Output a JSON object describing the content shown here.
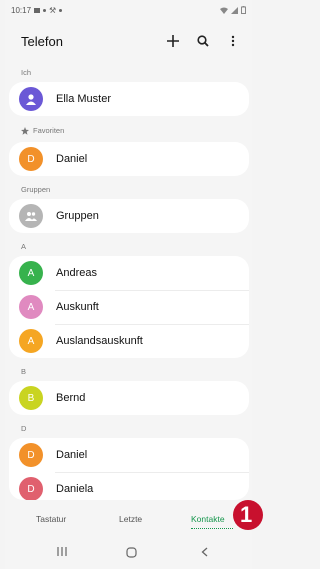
{
  "status": {
    "time": "10:17"
  },
  "header": {
    "title": "Telefon",
    "icons": [
      "plus-icon",
      "search-icon",
      "more-icon"
    ]
  },
  "sections": {
    "me": "Ich",
    "favorites": "Favoriten",
    "groups": "Gruppen",
    "a": "A",
    "b": "B",
    "d": "D"
  },
  "contacts": {
    "me": {
      "initial": "",
      "name": "Ella Muster",
      "color": "#6b58d6"
    },
    "fav_daniel": {
      "initial": "D",
      "name": "Daniel",
      "color": "#f2912a"
    },
    "groups": {
      "initial": "",
      "name": "Gruppen",
      "color": "#b5b5b5"
    },
    "andreas": {
      "initial": "A",
      "name": "Andreas",
      "color": "#37b24d"
    },
    "auskunft": {
      "initial": "A",
      "name": "Auskunft",
      "color": "#e08ac0"
    },
    "auslandsauskunft": {
      "initial": "A",
      "name": "Auslandsauskunft",
      "color": "#f5a623"
    },
    "bernd": {
      "initial": "B",
      "name": "Bernd",
      "color": "#c9d421"
    },
    "daniel": {
      "initial": "D",
      "name": "Daniel",
      "color": "#f2912a"
    },
    "daniela": {
      "initial": "D",
      "name": "Daniela",
      "color": "#e0606e"
    }
  },
  "tabs": {
    "keypad": "Tastatur",
    "recent": "Letzte",
    "contacts": "Kontakte"
  },
  "callout": "1",
  "colors": {
    "accent": "#15964c",
    "callout": "#c8102e"
  }
}
